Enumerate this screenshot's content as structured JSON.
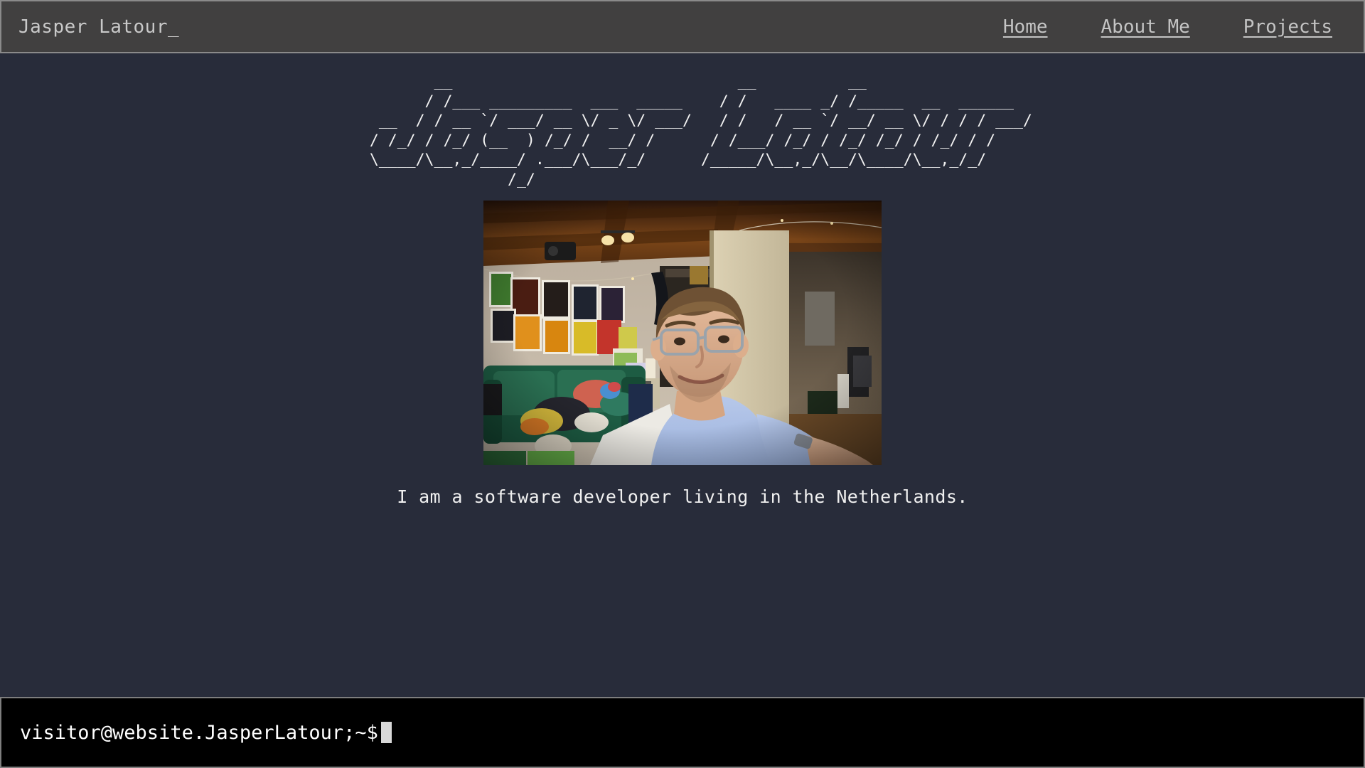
{
  "header": {
    "brand": "Jasper Latour_",
    "nav": [
      {
        "label": "Home",
        "name": "nav-link-home"
      },
      {
        "label": "About Me",
        "name": "nav-link-about-me"
      },
      {
        "label": "Projects",
        "name": "nav-link-projects"
      }
    ]
  },
  "main": {
    "ascii_banner": "           __                               __          __                  \n          / /___ _________  ___  _____    / /   ____ _/ /_____  __  ______\n     __  / / __ `/ ___/ __ \\/ _ \\/ ___/   / /   / __ `/ __/ __ \\/ / / / ___/\n    / /_/ / /_/ (__  ) /_/ /  __/ /      / /___/ /_/ / /_/ /_/ / /_/ / /    \n    \\____/\\__,_/____/ .___/\\___/_/      /_____/\\__,_/\\__/\\____/\\__,_/_/     \n                   /_/                                                     ",
    "ascii_text": "Jasper Latour",
    "photo_alt": "selfie-photo-of-jasper-latour-in-living-room",
    "tagline": "I am a software developer living in the Netherlands."
  },
  "terminal": {
    "prompt": "visitor@website.JasperLatour;~$",
    "cursor": "block-cursor",
    "command_value": "",
    "placeholder": ""
  },
  "colors": {
    "page_background": "#282c3a",
    "navbar_background": "#414040",
    "navbar_border": "#8a8a8a",
    "nav_link": "#c4c4c4",
    "brand_text": "#c9c9c9",
    "ascii_text": "#f2f2f2",
    "tagline_text": "#f0f0f0",
    "terminal_background": "#000000",
    "terminal_border": "#7e7e7e",
    "terminal_text": "#ffffff",
    "cursor": "#d8d8d8"
  }
}
